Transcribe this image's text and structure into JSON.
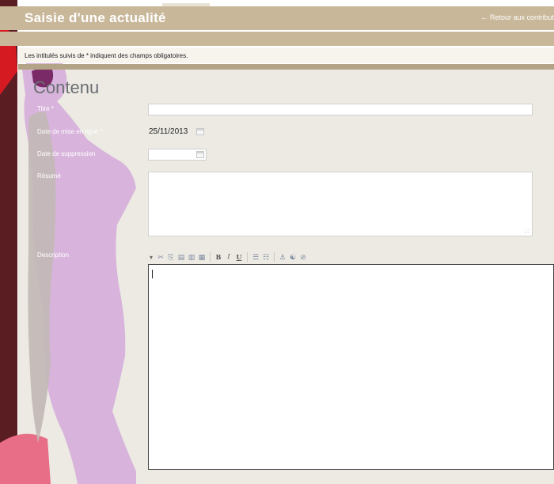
{
  "header": {
    "title": "Saisie d'une actualité",
    "back_link": "Retour aux contribut"
  },
  "notice": "Les intitulés suivis de * indiquent des champs obligatoires.",
  "section": {
    "title": "Contenu"
  },
  "fields": {
    "titre": {
      "label": "Titre *",
      "value": ""
    },
    "date_mise_en_ligne": {
      "label": "Date de mise en ligne *",
      "value": "25/11/2013"
    },
    "date_suppression": {
      "label": "Date de suppression",
      "value": ""
    },
    "resume": {
      "label": "Résumé",
      "value": ""
    },
    "description": {
      "label": "Description",
      "value": ""
    }
  },
  "toolbar": [
    {
      "name": "cut-icon",
      "glyph": "✂"
    },
    {
      "name": "copy-icon",
      "glyph": "⎘"
    },
    {
      "name": "paste-icon",
      "glyph": "▤"
    },
    {
      "name": "paste-text-icon",
      "glyph": "▥"
    },
    {
      "name": "paste-word-icon",
      "glyph": "▦"
    },
    {
      "name": "bold-icon",
      "glyph": "B"
    },
    {
      "name": "italic-icon",
      "glyph": "I"
    },
    {
      "name": "underline-icon",
      "glyph": "U"
    },
    {
      "name": "ordered-list-icon",
      "glyph": "☰"
    },
    {
      "name": "bullet-list-icon",
      "glyph": "☷"
    },
    {
      "name": "anchor-icon",
      "glyph": "⚓"
    },
    {
      "name": "link-icon",
      "glyph": "☯"
    },
    {
      "name": "unlink-icon",
      "glyph": "⊘"
    }
  ],
  "colors": {
    "header_bar": "#c9b79a",
    "panel": "#eceae3",
    "notice_bg": "#f7f4ee",
    "section_title": "#6b6f73",
    "deco_pink": "#d8b4dc",
    "deco_red": "#d61a22",
    "deco_dark": "#5a1e22"
  },
  "icons": {
    "back": "arrow-left-icon",
    "calendar": "calendar-icon"
  }
}
